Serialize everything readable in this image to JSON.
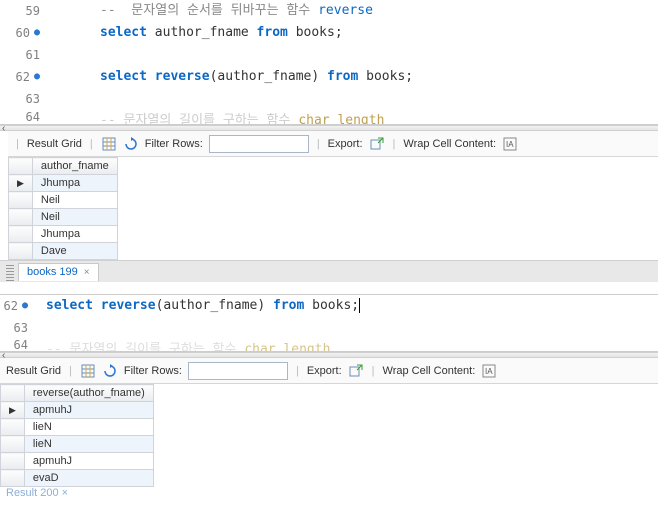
{
  "editor1": {
    "lines": [
      {
        "num": "59",
        "bullet": false
      },
      {
        "num": "60",
        "bullet": true
      },
      {
        "num": "61",
        "bullet": false
      },
      {
        "num": "62",
        "bullet": true
      },
      {
        "num": "63",
        "bullet": false
      },
      {
        "num": "64",
        "bullet": false
      }
    ],
    "comment_prefix": "-- ",
    "comment_text": " 문자열의 순서를 뒤바꾸는 함수 ",
    "comment_kw": "reverse",
    "kw_select": "select",
    "kw_from": "from",
    "kw_reverse": "reverse",
    "ident_author": "author_fname",
    "ident_books": "books",
    "semicolon": ";",
    "open_paren": "(",
    "close_paren": ")",
    "partial_comment": "-- 문자열의 길이를 구하는 함수 char_length",
    "partial_kw": "char_length"
  },
  "toolbar": {
    "result_grid": "Result Grid",
    "filter_rows": "Filter Rows:",
    "export": "Export:",
    "wrap": "Wrap Cell Content:"
  },
  "grid1": {
    "header": "author_fname",
    "rows": [
      "Jhumpa",
      "Neil",
      "Neil",
      "Jhumpa",
      "Dave"
    ]
  },
  "tab1": {
    "label": "books 199",
    "close": "×"
  },
  "editor2": {
    "lines": [
      {
        "num": "62",
        "bullet": true
      },
      {
        "num": "63",
        "bullet": false
      },
      {
        "num": "64",
        "bullet": false
      }
    ]
  },
  "grid2": {
    "header": "reverse(author_fname)",
    "rows": [
      "apmuhJ",
      "lieN",
      "lieN",
      "apmuhJ",
      "evaD"
    ]
  },
  "tab2_faded": "Result 200 ×"
}
